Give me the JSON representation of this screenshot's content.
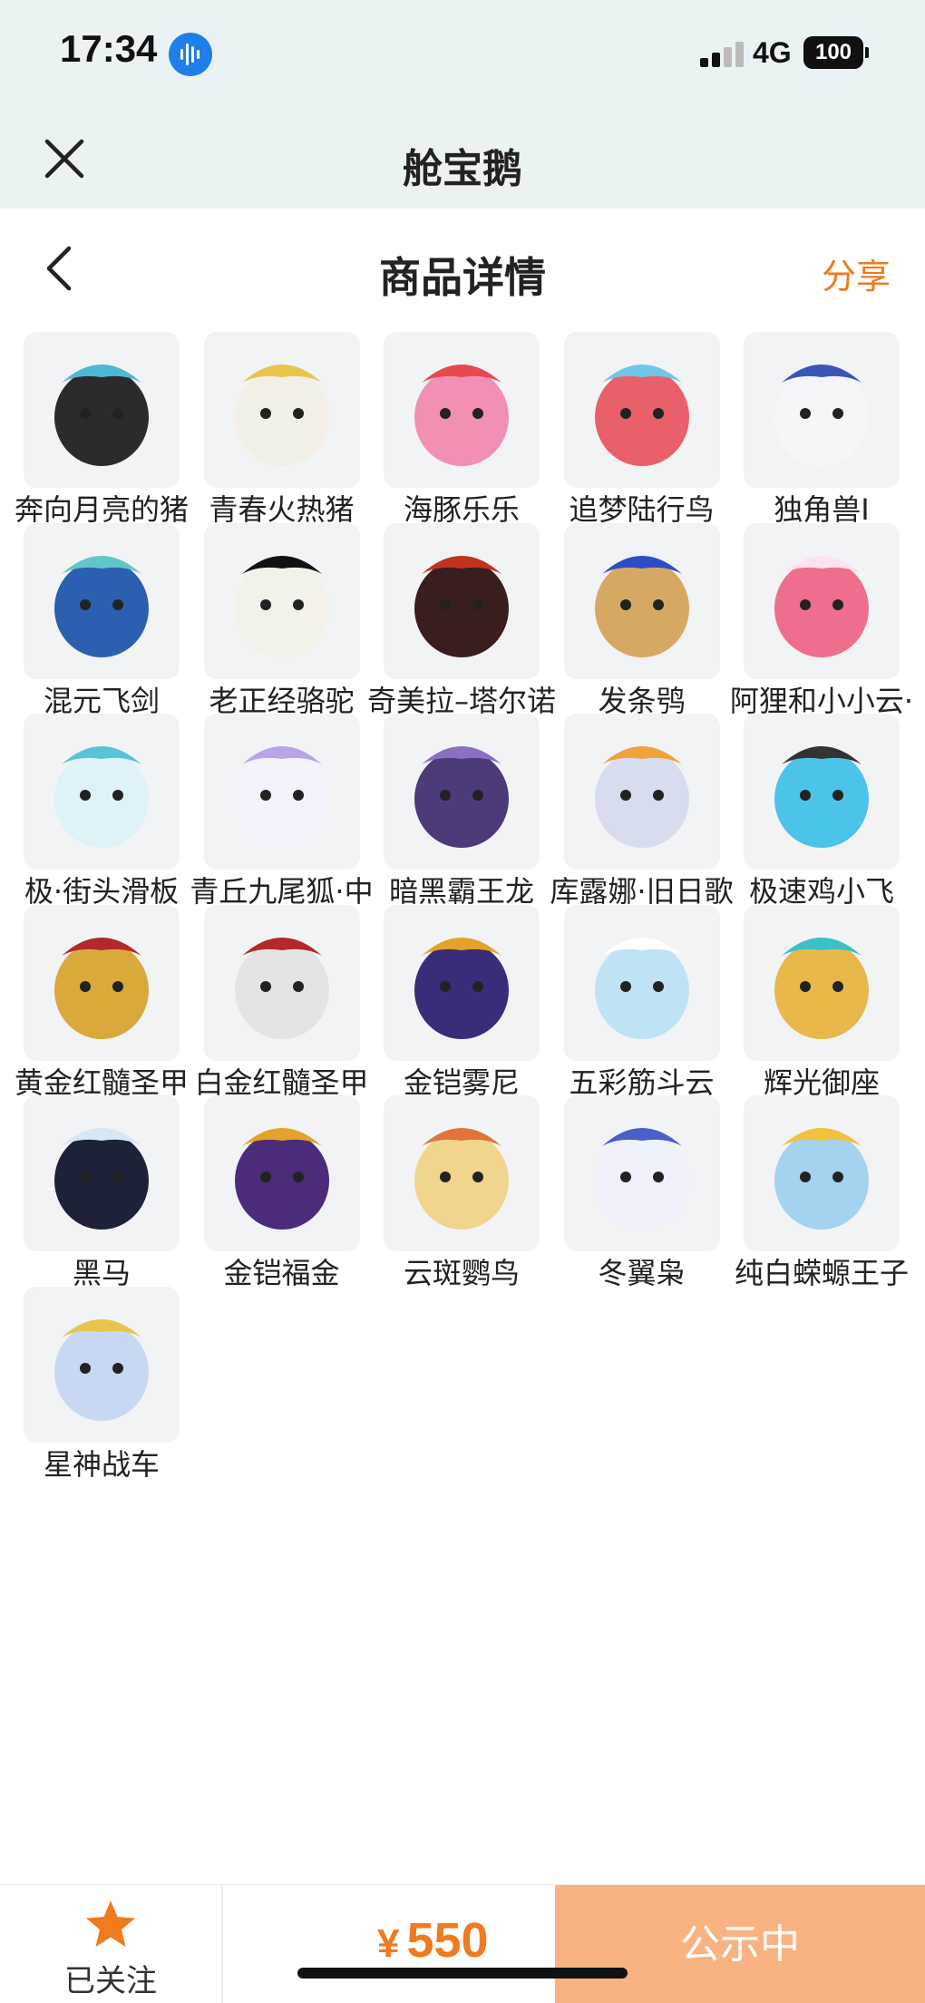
{
  "status_bar": {
    "time": "17:34",
    "network": "4G",
    "battery": "100"
  },
  "app_header": {
    "title": "舱宝鹅"
  },
  "page_header": {
    "title": "商品详情",
    "share_label": "分享"
  },
  "items": [
    {
      "name": "奔向月亮的猪猪怪",
      "icon": "pig-monster",
      "color": "#2b2b2b",
      "accent": "#4fb7d6"
    },
    {
      "name": "青春火热猪",
      "icon": "pig",
      "color": "#f4efe6",
      "accent": "#e7c54c"
    },
    {
      "name": "海豚乐乐",
      "icon": "dolphin",
      "color": "#f28fb6",
      "accent": "#e64950"
    },
    {
      "name": "追梦陆行鸟",
      "icon": "bird",
      "color": "#e9606a",
      "accent": "#6fc7e8"
    },
    {
      "name": "独角兽I",
      "icon": "unicorn",
      "color": "#f5f6fb",
      "accent": "#3a56b8"
    },
    {
      "name": "混元飞剑",
      "icon": "sword",
      "color": "#2d5fb0",
      "accent": "#61c6c9"
    },
    {
      "name": "老正经骆驼",
      "icon": "camel",
      "color": "#f4f1ea",
      "accent": "#111111"
    },
    {
      "name": "奇美拉–塔尔诺斯",
      "icon": "chimera",
      "color": "#3a1e1e",
      "accent": "#c0331f"
    },
    {
      "name": "发条鸮",
      "icon": "owl",
      "color": "#d6a962",
      "accent": "#2f4bc7"
    },
    {
      "name": "阿狸和小小云·高",
      "icon": "fox",
      "color": "#ee6f8c",
      "accent": "#fbe3f0"
    },
    {
      "name": "极·街头滑板",
      "icon": "skateboard",
      "color": "#dff2f7",
      "accent": "#5bc3d8"
    },
    {
      "name": "青丘九尾狐·中",
      "icon": "nine-tail-fox",
      "color": "#f4f3fb",
      "accent": "#b8a4e6"
    },
    {
      "name": "暗黑霸王龙",
      "icon": "dinosaur",
      "color": "#4d3a78",
      "accent": "#8b6fc0"
    },
    {
      "name": "库露娜·旧日歌者",
      "icon": "singer",
      "color": "#d7dcef",
      "accent": "#f0a33c"
    },
    {
      "name": "极速鸡小飞",
      "icon": "chick",
      "color": "#4cc3e8",
      "accent": "#333333"
    },
    {
      "name": "黄金红髓圣甲虫",
      "icon": "beetle-gold",
      "color": "#d9a93c",
      "accent": "#b3282b"
    },
    {
      "name": "白金红髓圣甲虫",
      "icon": "beetle-white",
      "color": "#e4e4e6",
      "accent": "#b3282b"
    },
    {
      "name": "金铠雾尼",
      "icon": "armored-beast",
      "color": "#3a2c79",
      "accent": "#e3a32a"
    },
    {
      "name": "五彩筋斗云",
      "icon": "cloud",
      "color": "#bfe3f4",
      "accent": "#ffffff"
    },
    {
      "name": "辉光御座",
      "icon": "throne",
      "color": "#e8b84a",
      "accent": "#3cc0c8"
    },
    {
      "name": "黑马",
      "icon": "horse",
      "color": "#1d2238",
      "accent": "#d6e7f5"
    },
    {
      "name": "金铠福金",
      "icon": "armored-dragon",
      "color": "#4a2c7a",
      "accent": "#e3a32a"
    },
    {
      "name": "云斑鹦鸟",
      "icon": "parrot",
      "color": "#f2d58c",
      "accent": "#e0743a"
    },
    {
      "name": "冬翼枭",
      "icon": "winter-owl",
      "color": "#eef2fb",
      "accent": "#4a5fc8"
    },
    {
      "name": "纯白蝾螈王子",
      "icon": "axolotl",
      "color": "#a4d2ef",
      "accent": "#f2c23e"
    },
    {
      "name": "星神战车",
      "icon": "pegasus",
      "color": "#c9d8f2",
      "accent": "#e7c54c"
    }
  ],
  "bottom_bar": {
    "follow_label": "已关注",
    "currency": "¥",
    "price": "550",
    "status_label": "公示中"
  },
  "colors": {
    "accent_orange": "#f07a1e",
    "status_button": "#f9b281",
    "header_bg": "#eaf2f6"
  }
}
